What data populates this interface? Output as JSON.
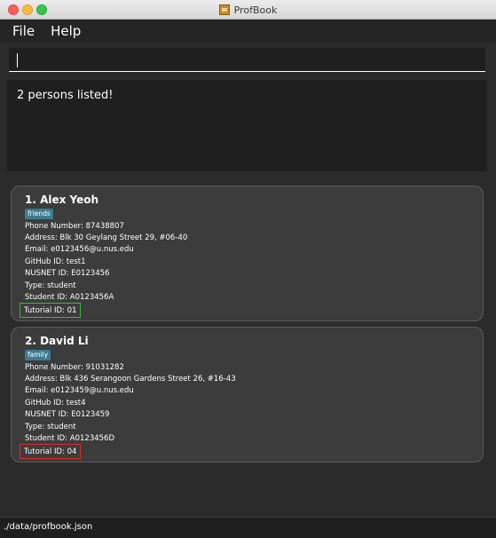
{
  "window": {
    "title": "ProfBook"
  },
  "menu": {
    "items": [
      "File",
      "Help"
    ]
  },
  "command": {
    "value": ""
  },
  "result": {
    "text": "2 persons listed!"
  },
  "persons": [
    {
      "name": "1.  Alex Yeoh",
      "tag": "friends",
      "phone": "Phone Number: 87438807",
      "address": "Address: Blk 30 Geylang Street 29, #06-40",
      "email": "Email: e0123456@u.nus.edu",
      "github": "GitHub ID: test1",
      "nusnet": "NUSNET ID: E0123456",
      "type": "Type: student",
      "student_id": "Student ID: A0123456A",
      "tutorial": "Tutorial ID: 01"
    },
    {
      "name": "2.  David Li",
      "tag": "family",
      "phone": "Phone Number: 91031282",
      "address": "Address: Blk 436 Serangoon Gardens Street 26, #16-43",
      "email": "Email: e0123459@u.nus.edu",
      "github": "GitHub ID: test4",
      "nusnet": "NUSNET ID: E0123459",
      "type": "Type: student",
      "student_id": "Student ID: A0123456D",
      "tutorial": "Tutorial ID: 04"
    }
  ],
  "highlight_colors": {
    "first_tutorial": "#2fbf40",
    "second_tutorial": "#e02a2a"
  },
  "status": {
    "path": "./data/profbook.json"
  }
}
